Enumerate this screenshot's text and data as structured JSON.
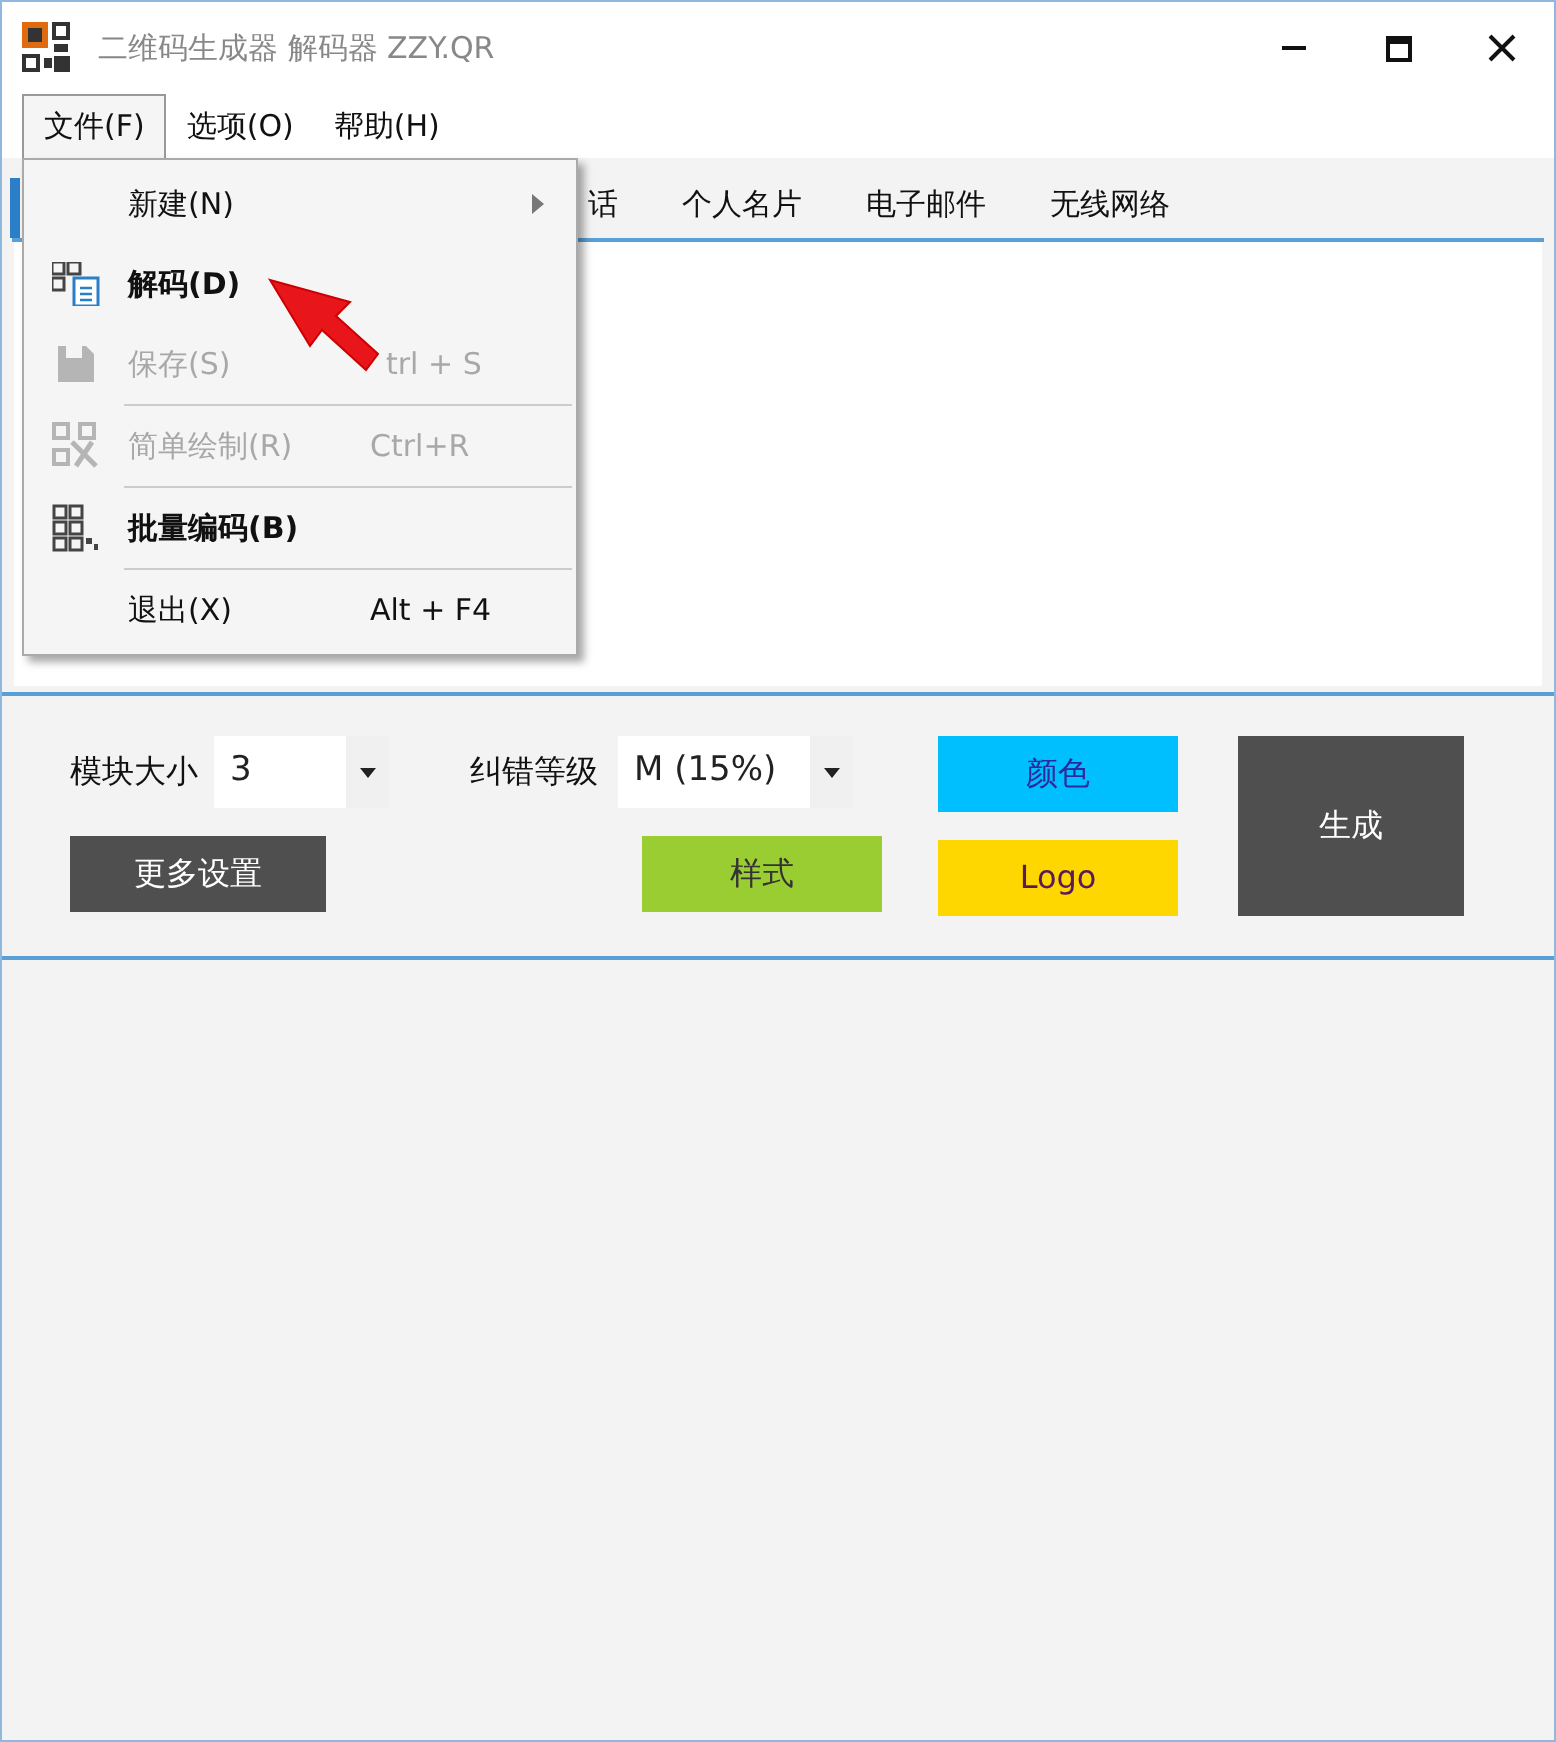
{
  "window": {
    "title": "二维码生成器 解码器 ZZY.QR"
  },
  "menubar": [
    {
      "label": "文件(F)",
      "selected": true
    },
    {
      "label": "选项(O)",
      "selected": false
    },
    {
      "label": "帮助(H)",
      "selected": false
    }
  ],
  "file_menu": [
    {
      "label": "新建(N)",
      "submenu": true,
      "bold": false,
      "disabled": false,
      "separator_after": false
    },
    {
      "label": "解码(D)",
      "bold": true,
      "disabled": false,
      "separator_after": false
    },
    {
      "label": "保存(S)",
      "shortcut": "trl + S",
      "bold": false,
      "disabled": true,
      "separator_after": true
    },
    {
      "label": "简单绘制(R)",
      "shortcut": "Ctrl+R",
      "bold": false,
      "disabled": true,
      "separator_after": true
    },
    {
      "label": "批量编码(B)",
      "bold": true,
      "disabled": false,
      "separator_after": true
    },
    {
      "label": "退出(X)",
      "shortcut": "Alt + F4",
      "bold": false,
      "disabled": false,
      "separator_after": false
    }
  ],
  "tabs": [
    {
      "label": "话",
      "selected": false
    },
    {
      "label": "个人名片",
      "selected": false
    },
    {
      "label": "电子邮件",
      "selected": false
    },
    {
      "label": "无线网络",
      "selected": false
    }
  ],
  "settings": {
    "module_size": {
      "label": "模块大小",
      "value": "3"
    },
    "error_level": {
      "label": "纠错等级",
      "value": "M (15%)"
    },
    "more_button": "更多设置",
    "buttons": [
      {
        "label": "样式",
        "color": "#9acd32"
      },
      {
        "label": "颜色",
        "color": "#00bfff"
      },
      {
        "label": "Logo",
        "color": "#ffd700"
      }
    ],
    "generate_button": "生成"
  }
}
